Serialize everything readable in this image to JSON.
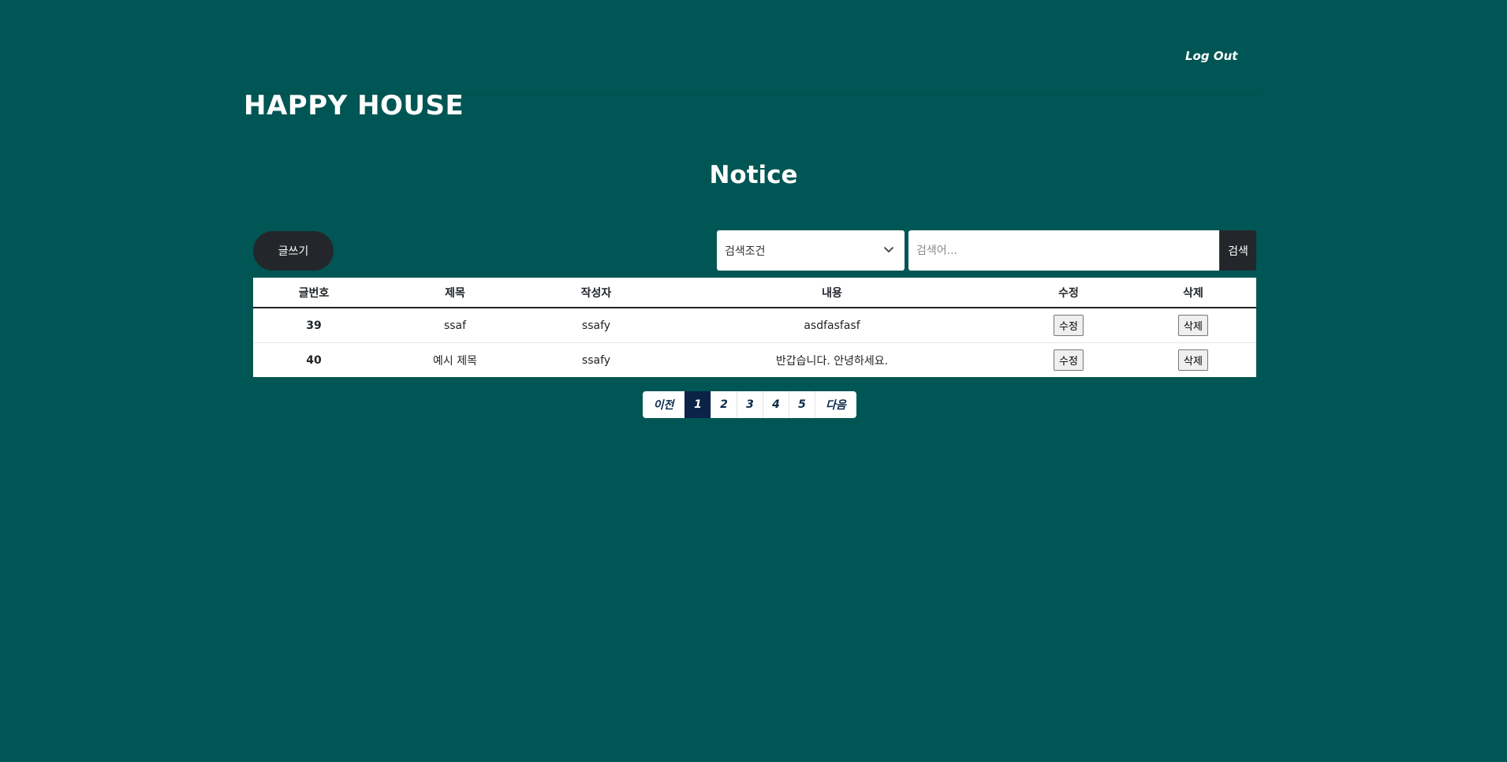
{
  "header": {
    "logout_label": "Log Out",
    "brand": "HAPPY HOUSE"
  },
  "page": {
    "title": "Notice"
  },
  "toolbar": {
    "write_label": "글쓰기",
    "search_condition_label": "검색조건",
    "search_placeholder": "검색어...",
    "search_button_label": "검색"
  },
  "table": {
    "columns": [
      "글번호",
      "제목",
      "작성자",
      "내용",
      "수정",
      "삭제"
    ],
    "rows": [
      {
        "no": "39",
        "title": "ssaf",
        "author": "ssafy",
        "content": "asdfasfasf",
        "edit": "수정",
        "delete": "삭제"
      },
      {
        "no": "40",
        "title": "예시 제목",
        "author": "ssafy",
        "content": "반갑습니다. 안녕하세요.",
        "edit": "수정",
        "delete": "삭제"
      }
    ]
  },
  "pagination": {
    "prev_label": "이전",
    "pages": [
      "1",
      "2",
      "3",
      "4",
      "5"
    ],
    "active_page": "1",
    "next_label": "다음"
  },
  "colors": {
    "background": "#005654",
    "dark_button": "#23272b",
    "active_page": "#0b2346"
  }
}
